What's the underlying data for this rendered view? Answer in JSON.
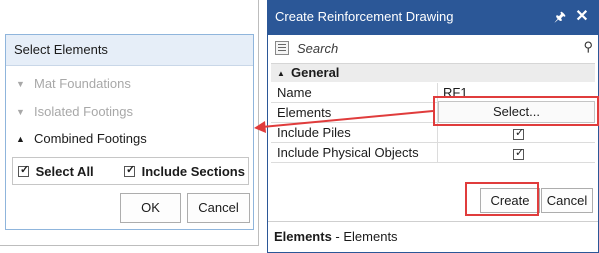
{
  "select_dialog": {
    "title": "Select Elements",
    "tree": [
      {
        "label": "Mat Foundations",
        "enabled": false
      },
      {
        "label": "Isolated Footings",
        "enabled": false
      },
      {
        "label": "Combined Footings",
        "enabled": true
      }
    ],
    "select_all_label": "Select All",
    "select_all_checked": true,
    "include_sections_label": "Include Sections",
    "include_sections_checked": true,
    "ok_label": "OK",
    "cancel_label": "Cancel"
  },
  "drawing_panel": {
    "title": "Create Reinforcement Drawing",
    "pin_icon": "pin-icon",
    "close_icon": "close-icon",
    "search_placeholder": "Search",
    "group_label": "General",
    "properties": [
      {
        "name": "Name",
        "value": "RF1"
      },
      {
        "name": "Elements",
        "value": "Select..."
      },
      {
        "name": "Include Piles",
        "checked": true
      },
      {
        "name": "Include Physical Objects",
        "checked": true
      }
    ],
    "create_label": "Create",
    "cancel_label": "Cancel",
    "description_name": "Elements",
    "description_text": " - Elements"
  },
  "colors": {
    "title_bar": "#2b5797",
    "highlight": "#e03c3c",
    "dialog_header": "#e6eef8"
  }
}
